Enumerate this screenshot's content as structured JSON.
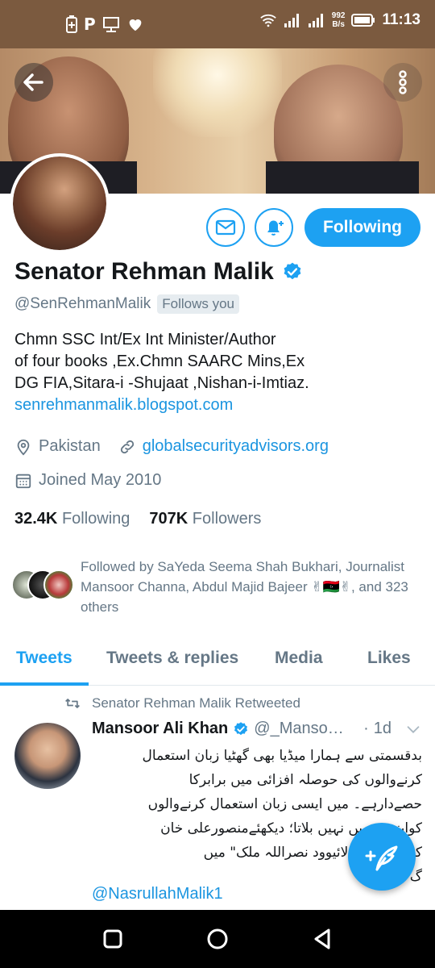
{
  "status_bar": {
    "speed_value": "992",
    "speed_unit": "B/s",
    "time": "11:13",
    "left_glyphs": [
      "P"
    ],
    "icons": [
      "battery-plus-icon",
      "p-icon",
      "tv-icon",
      "heart-icon",
      "wifi-icon",
      "signal-icon",
      "signal-icon",
      "battery-icon"
    ]
  },
  "profile": {
    "name": "Senator Rehman Malik",
    "handle": "@SenRehmanMalik",
    "follows_you": "Follows you",
    "bio_lines": [
      "Chmn SSC Int/Ex Int Minister/Author",
      "of  four books ,Ex.Chmn SAARC Mins,Ex",
      "DG FIA,Sitara-i -Shujaat ,Nishan-i-Imtiaz."
    ],
    "bio_link": "senrehmanmalik.blogspot.com",
    "location": "Pakistan",
    "website": "globalsecurityadvisors.org",
    "joined": "Joined May 2010",
    "following_count": "32.4K",
    "following_label": "Following",
    "followers_count": "707K",
    "followers_label": "Followers",
    "followed_by": "Followed by SaYeda Seema Shah Bukhari, Journalist Mansoor Channa, Abdul Majid Bajeer ✌🇱🇾✌, and 323 others",
    "follow_button": "Following"
  },
  "tabs": [
    "Tweets",
    "Tweets & replies",
    "Media",
    "Likes"
  ],
  "tweet": {
    "retweet_label": "Senator Rehman Malik Retweeted",
    "author_name": "Mansoor Ali Khan",
    "author_handle": "@_Manso…",
    "time": "1d",
    "text_lines": [
      "بدقسمتی سے ہمارا میڈیا بھی گھٹیا زبان استعمال",
      "کرنےوالوں کی حوصلہ افزائی میں برابرکا",
      "حصےدارہے۔ میں ایسی زبان استعمال کرنےوالوں",
      "کواپنےشومیں نہیں بلاتا؛ دیکھئےمنصورعلی خان",
      "کےپروگرام \" لائیوود نصراللہ ملک\" میں",
      "گ"
    ],
    "mention": "@NasrullahMalik1"
  },
  "colors": {
    "accent": "#1da1f2",
    "link": "#1b95e0",
    "status_bar": "#7b5a3f",
    "muted": "#657786"
  }
}
